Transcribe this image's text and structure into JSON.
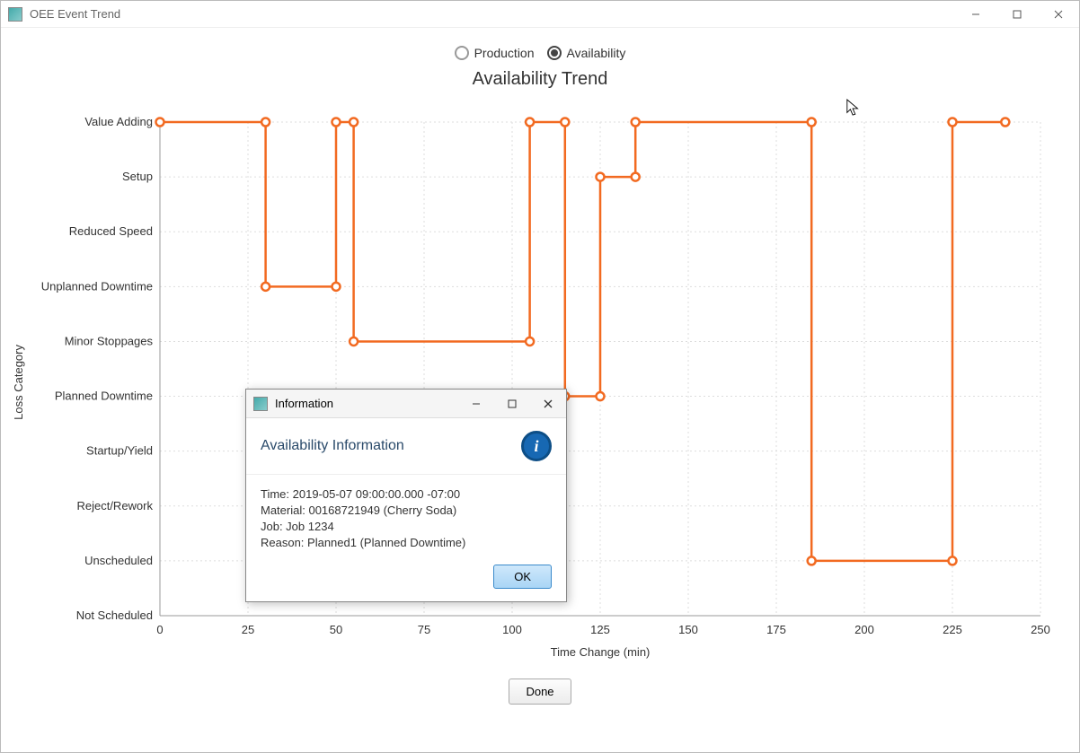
{
  "window": {
    "title": "OEE Event Trend"
  },
  "radios": {
    "production": "Production",
    "availability": "Availability",
    "selected": "availability"
  },
  "chart": {
    "title": "Availability Trend",
    "xlabel": "Time Change (min)",
    "ylabel": "Loss Category"
  },
  "buttons": {
    "done": "Done",
    "ok": "OK"
  },
  "dialog": {
    "winTitle": "Information",
    "headTitle": "Availability Information",
    "line1": "Time: 2019-05-07 09:00:00.000 -07:00",
    "line2": "Material: 00168721949 (Cherry Soda)",
    "line3": "Job: Job 1234",
    "line4": "Reason: Planned1 (Planned Downtime)"
  },
  "chart_data": {
    "type": "line",
    "title": "Availability Trend",
    "xlabel": "Time Change (min)",
    "ylabel": "Loss Category",
    "xlim": [
      0,
      250
    ],
    "x_ticks": [
      0,
      25,
      50,
      75,
      100,
      125,
      150,
      175,
      200,
      225,
      250
    ],
    "y_categories": [
      "Not Scheduled",
      "Unscheduled",
      "Reject/Rework",
      "Startup/Yield",
      "Planned Downtime",
      "Minor Stoppages",
      "Unplanned Downtime",
      "Reduced Speed",
      "Setup",
      "Value Adding"
    ],
    "series": [
      {
        "name": "Availability",
        "color": "#f26a21",
        "points": [
          {
            "x": 0,
            "y": "Value Adding"
          },
          {
            "x": 30,
            "y": "Value Adding"
          },
          {
            "x": 30,
            "y": "Unplanned Downtime"
          },
          {
            "x": 50,
            "y": "Unplanned Downtime"
          },
          {
            "x": 50,
            "y": "Value Adding"
          },
          {
            "x": 55,
            "y": "Value Adding"
          },
          {
            "x": 55,
            "y": "Minor Stoppages"
          },
          {
            "x": 105,
            "y": "Minor Stoppages"
          },
          {
            "x": 105,
            "y": "Value Adding"
          },
          {
            "x": 115,
            "y": "Value Adding"
          },
          {
            "x": 115,
            "y": "Planned Downtime"
          },
          {
            "x": 125,
            "y": "Planned Downtime"
          },
          {
            "x": 125,
            "y": "Setup"
          },
          {
            "x": 135,
            "y": "Setup"
          },
          {
            "x": 135,
            "y": "Value Adding"
          },
          {
            "x": 185,
            "y": "Value Adding"
          },
          {
            "x": 185,
            "y": "Unscheduled"
          },
          {
            "x": 225,
            "y": "Unscheduled"
          },
          {
            "x": 225,
            "y": "Value Adding"
          },
          {
            "x": 240,
            "y": "Value Adding"
          }
        ]
      }
    ]
  }
}
